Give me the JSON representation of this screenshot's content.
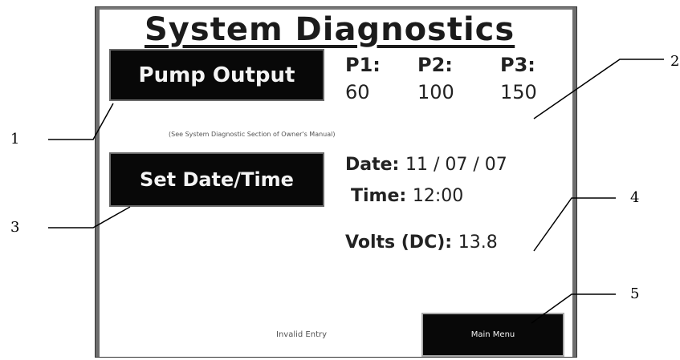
{
  "screen": {
    "title": "System Diagnostics",
    "pump_button": "Pump Output",
    "note": "(See System Diagnostic Section of Owner's Manual)",
    "pumps": [
      {
        "label": "P1:",
        "value": "60"
      },
      {
        "label": "P2:",
        "value": "100"
      },
      {
        "label": "P3:",
        "value": "150"
      }
    ],
    "date_time_button": "Set Date/Time",
    "date_label": "Date:",
    "date_value": "11 / 07 / 07",
    "time_label": "Time:",
    "time_value": "12:00",
    "volts_label": "Volts (DC):",
    "volts_value": "13.8",
    "invalid_entry": "Invalid Entry",
    "main_menu_button": "Main Menu"
  },
  "callouts": [
    "1",
    "2",
    "3",
    "4",
    "5"
  ]
}
